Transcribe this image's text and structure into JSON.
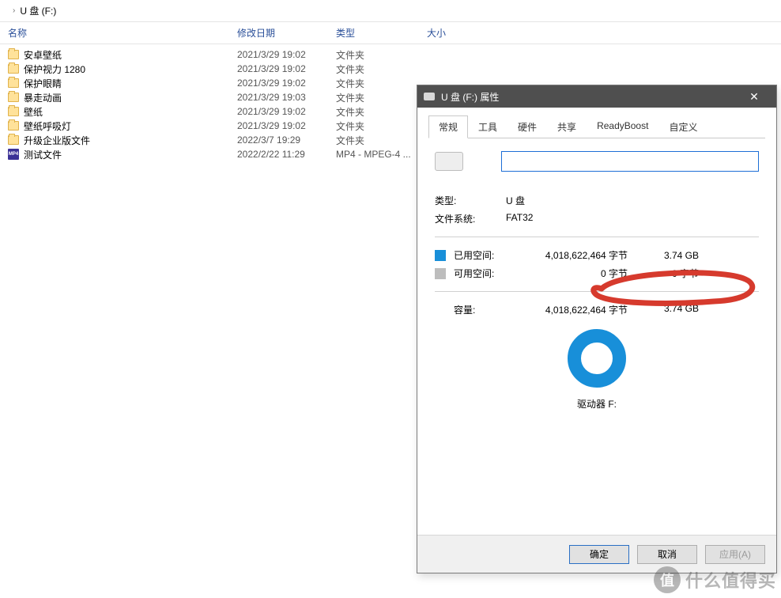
{
  "breadcrumb": {
    "path": "U 盘 (F:)"
  },
  "columns": {
    "name": "名称",
    "date": "修改日期",
    "type": "类型",
    "size": "大小"
  },
  "rows": [
    {
      "icon": "folder",
      "name": "安卓壁纸",
      "date": "2021/3/29 19:02",
      "type": "文件夹"
    },
    {
      "icon": "folder",
      "name": "保护视力 1280",
      "date": "2021/3/29 19:02",
      "type": "文件夹"
    },
    {
      "icon": "folder",
      "name": "保护眼睛",
      "date": "2021/3/29 19:02",
      "type": "文件夹"
    },
    {
      "icon": "folder",
      "name": "暴走动画",
      "date": "2021/3/29 19:03",
      "type": "文件夹"
    },
    {
      "icon": "folder",
      "name": "壁纸",
      "date": "2021/3/29 19:02",
      "type": "文件夹"
    },
    {
      "icon": "folder",
      "name": "壁纸呼吸灯",
      "date": "2021/3/29 19:02",
      "type": "文件夹"
    },
    {
      "icon": "folder",
      "name": "升级企业版文件",
      "date": "2022/3/7 19:29",
      "type": "文件夹"
    },
    {
      "icon": "mp4",
      "name": "测试文件",
      "date": "2022/2/22 11:29",
      "type": "MP4 - MPEG-4 ..."
    }
  ],
  "dialog": {
    "title": "U 盘 (F:) 属性",
    "tabs": [
      "常规",
      "工具",
      "硬件",
      "共享",
      "ReadyBoost",
      "自定义"
    ],
    "active_tab": 0,
    "name_value": "",
    "type_label": "类型:",
    "type_value": "U 盘",
    "fs_label": "文件系统:",
    "fs_value": "FAT32",
    "used_label": "已用空间:",
    "used_bytes": "4,018,622,464 字节",
    "used_gb": "3.74 GB",
    "free_label": "可用空间:",
    "free_bytes": "0 字节",
    "free_gb": "0 字节",
    "cap_label": "容量:",
    "cap_bytes": "4,018,622,464 字节",
    "cap_gb": "3.74 GB",
    "drive_label": "驱动器 F:",
    "buttons": {
      "ok": "确定",
      "cancel": "取消",
      "apply": "应用(A)"
    }
  },
  "watermark": {
    "glyph": "值",
    "text": "什么值得买"
  },
  "colors": {
    "accent": "#188fd9",
    "titlebar": "#4f4f4f",
    "annotation": "#d63a2d"
  }
}
